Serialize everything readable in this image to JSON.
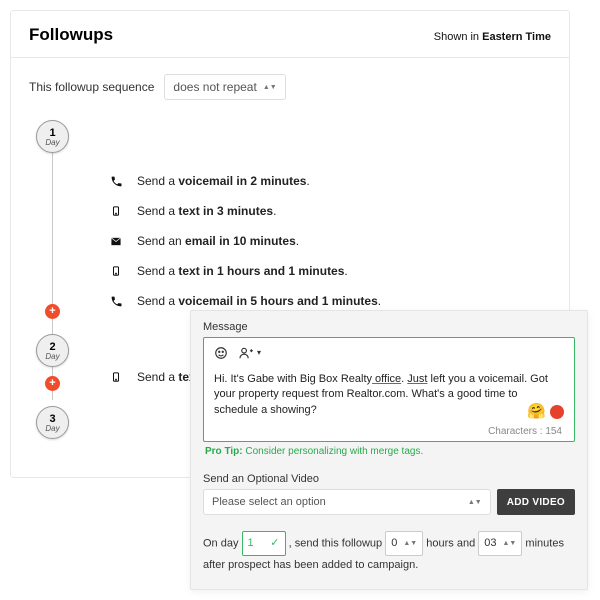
{
  "header": {
    "title": "Followups",
    "shown_in_prefix": "Shown in ",
    "timezone": "Eastern Time"
  },
  "repeat": {
    "label": "This followup sequence",
    "value": "does not repeat"
  },
  "days": [
    {
      "num": "1",
      "label": "Day"
    },
    {
      "num": "2",
      "label": "Day"
    },
    {
      "num": "3",
      "label": "Day"
    }
  ],
  "steps": [
    {
      "icon": "phone",
      "prefix": "Send a ",
      "bold": "voicemail in 2 minutes",
      "suffix": "."
    },
    {
      "icon": "mobile",
      "prefix": "Send a ",
      "bold": "text in 3 minutes",
      "suffix": "."
    },
    {
      "icon": "mail",
      "prefix": "Send an ",
      "bold": "email in 10 minutes",
      "suffix": "."
    },
    {
      "icon": "mobile",
      "prefix": "Send a ",
      "bold": "text in 1 hours and 1 minutes",
      "suffix": "."
    },
    {
      "icon": "phone",
      "prefix": "Send a ",
      "bold": "voicemail in 5 hours and 1 minutes",
      "suffix": "."
    },
    {
      "icon": "mobile",
      "prefix": "Send a ",
      "bold": "text",
      "suffix": ""
    }
  ],
  "message": {
    "label": "Message",
    "body_pre": "Hi. It's Gabe with Big Box Realty",
    "body_uline1": " office",
    "body_mid": ". ",
    "body_uline2": "Just",
    "body_post": " left you a voicemail. Got your property request from Realtor.com. What's a good time to schedule a showing?",
    "charcount_label": "Characters :",
    "charcount": "154",
    "protip_prefix": "Pro Tip:",
    "protip_rest": " Consider personalizing with merge tags."
  },
  "video": {
    "label": "Send an Optional Video",
    "placeholder": "Please select an option",
    "button": "ADD VIDEO"
  },
  "schedule": {
    "p1": "On day ",
    "day": "1",
    "p2": " , send this followup ",
    "hours": "0",
    "p3": " hours and ",
    "minutes": "03",
    "p4": " minutes after prospect has been added to campaign."
  }
}
